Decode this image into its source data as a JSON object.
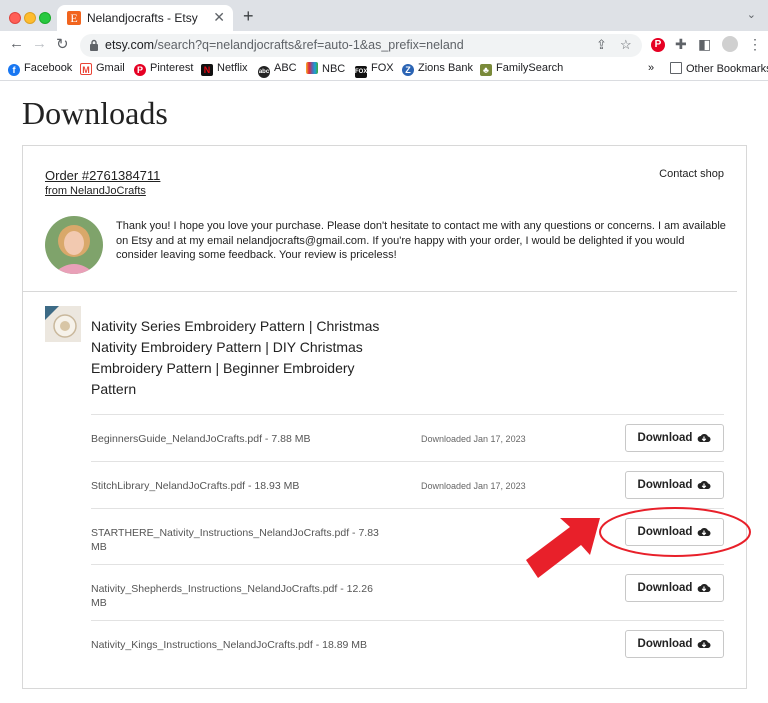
{
  "browser": {
    "tab_title": "Nelandjocrafts - Etsy",
    "tab_favicon": "E",
    "url_host": "etsy.com",
    "url_rest": "/search?q=nelandjocrafts&ref=auto-1&as_prefix=neland",
    "bookmarks": [
      {
        "label": "Facebook",
        "icon": "facebook-icon",
        "color": "#1877f2"
      },
      {
        "label": "Gmail",
        "icon": "gmail-icon",
        "color": "#ea4335"
      },
      {
        "label": "Pinterest",
        "icon": "pinterest-icon",
        "color": "#e60023"
      },
      {
        "label": "Netflix",
        "icon": "netflix-icon",
        "color": "#e50914"
      },
      {
        "label": "ABC",
        "icon": "abc-icon",
        "color": "#222222"
      },
      {
        "label": "NBC",
        "icon": "nbc-icon",
        "color": "#6460aa"
      },
      {
        "label": "FOX",
        "icon": "fox-icon",
        "color": "#111111"
      },
      {
        "label": "Zions Bank",
        "icon": "zions-bank-icon",
        "color": "#2b64b4"
      },
      {
        "label": "FamilySearch",
        "icon": "familysearch-icon",
        "color": "#7a8a3a"
      }
    ],
    "overflow_label": "»",
    "other_bookmarks": "Other Bookmarks"
  },
  "page": {
    "title": "Downloads",
    "order_number": "Order #2761384711",
    "from_shop": "from NelandJoCrafts",
    "contact_shop": "Contact shop",
    "seller_message": "Thank you! I hope you love your purchase. Please don't hesitate to contact me with any questions or concerns. I am available on Etsy and at my email nelandjocrafts@gmail.com. If you're happy with your order, I would be delighted if you would consider leaving some feedback. Your review is priceless!",
    "product_title": "Nativity Series Embroidery Pattern | Christmas Nativity Embroidery Pattern | DIY Christmas Embroidery Pattern | Beginner Embroidery Pattern",
    "files": [
      {
        "name": "BeginnersGuide_NelandJoCrafts.pdf - 7.88 MB",
        "date": "Downloaded Jan 17, 2023",
        "button": "Download"
      },
      {
        "name": "StitchLibrary_NelandJoCrafts.pdf - 18.93 MB",
        "date": "Downloaded Jan 17, 2023",
        "button": "Download"
      },
      {
        "name": "STARTHERE_Nativity_Instructions_NelandJoCrafts.pdf - 7.83 MB",
        "date": "",
        "button": "Download"
      },
      {
        "name": "Nativity_Shepherds_Instructions_NelandJoCrafts.pdf - 12.26 MB",
        "date": "",
        "button": "Download"
      },
      {
        "name": "Nativity_Kings_Instructions_NelandJoCrafts.pdf - 18.89 MB",
        "date": "",
        "button": "Download"
      }
    ]
  },
  "colors": {
    "etsy_orange": "#f1641e",
    "annotation_red": "#e8202a"
  }
}
